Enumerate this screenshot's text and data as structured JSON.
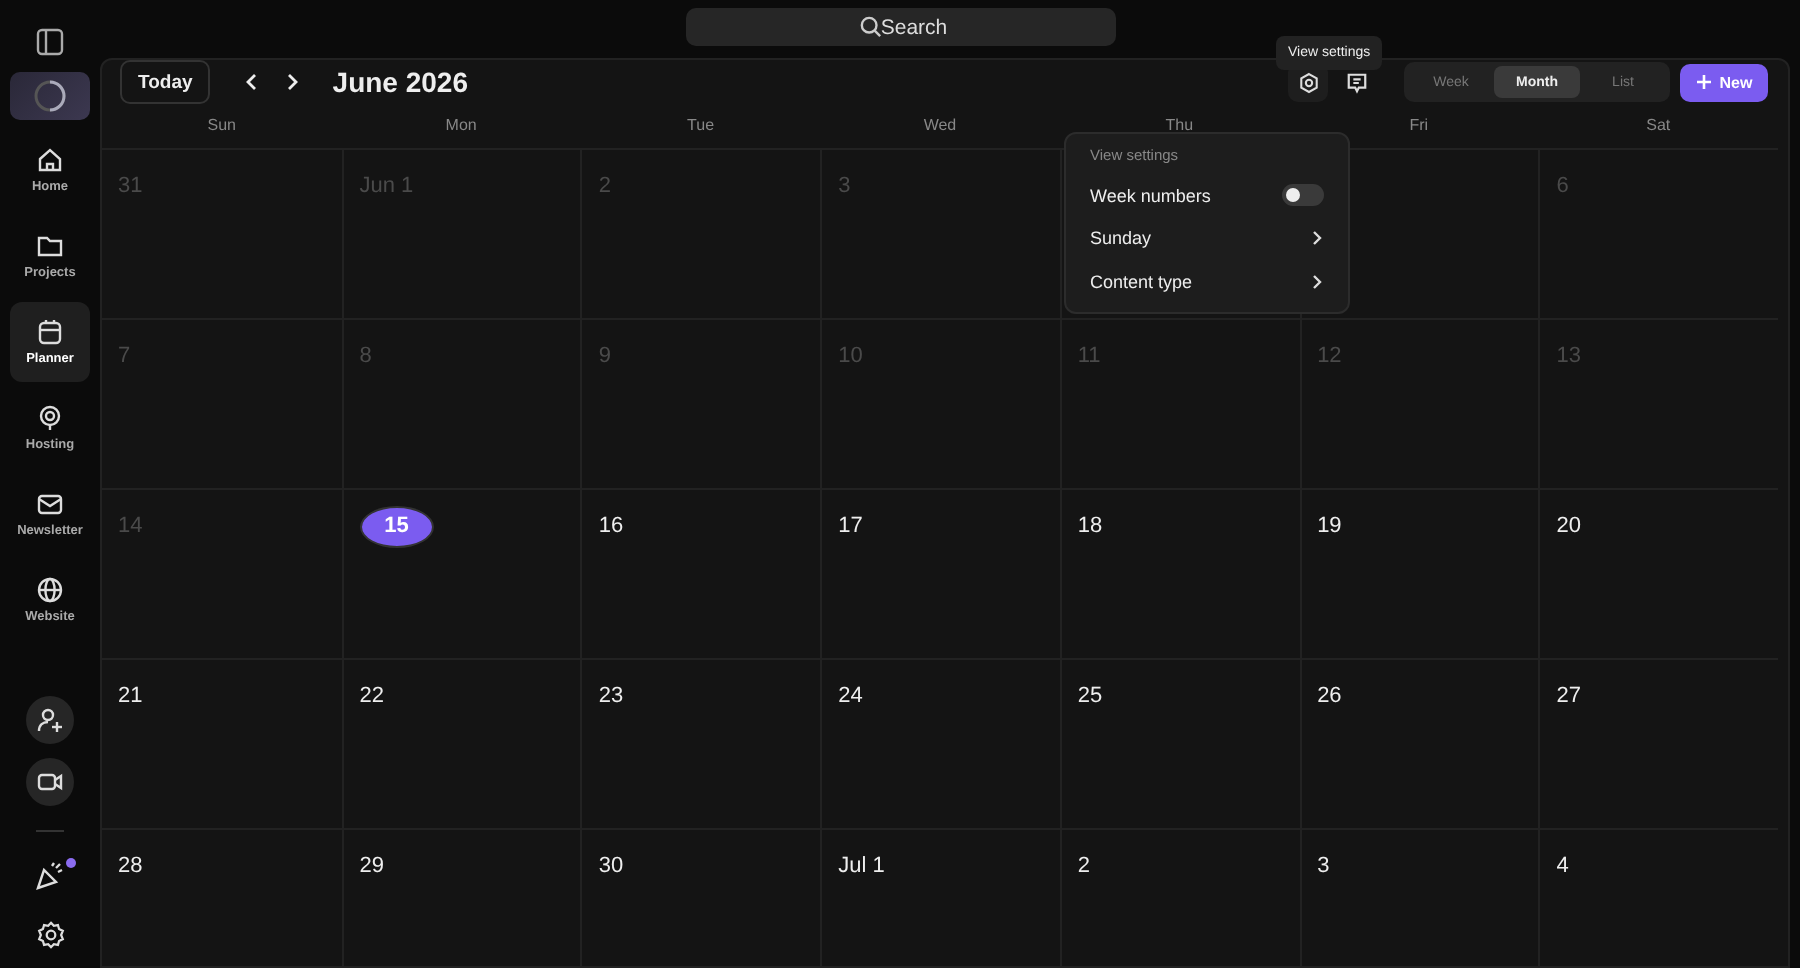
{
  "search": {
    "placeholder": "Search"
  },
  "sidebar": {
    "items": [
      {
        "label": "Home",
        "selected": false
      },
      {
        "label": "Projects",
        "selected": false
      },
      {
        "label": "Planner",
        "selected": true
      },
      {
        "label": "Hosting",
        "selected": false
      },
      {
        "label": "Newsletter",
        "selected": false
      },
      {
        "label": "Website",
        "selected": false
      }
    ],
    "notification_dot": true
  },
  "toolbar": {
    "today_button": "Today",
    "title": "June 2026",
    "tooltip": "View settings",
    "views": [
      {
        "label": "Week",
        "selected": false
      },
      {
        "label": "Month",
        "selected": true
      },
      {
        "label": "List",
        "selected": false
      }
    ],
    "new_button": "New"
  },
  "view_settings_menu": {
    "title": "View settings",
    "items": [
      {
        "kind": "toggle",
        "label": "Week numbers",
        "on": false
      },
      {
        "kind": "submenu",
        "label": "Sunday"
      },
      {
        "kind": "submenu",
        "label": "Content type"
      }
    ]
  },
  "calendar": {
    "weekdays": [
      "Sun",
      "Mon",
      "Tue",
      "Wed",
      "Thu",
      "Fri",
      "Sat"
    ],
    "weeks": [
      [
        {
          "label": "31",
          "past": true,
          "today": false
        },
        {
          "label": "Jun 1",
          "past": true,
          "today": false
        },
        {
          "label": "2",
          "past": true,
          "today": false
        },
        {
          "label": "3",
          "past": true,
          "today": false
        },
        {
          "label": "6",
          "past": true,
          "today": false
        }
      ],
      [
        {
          "label": "7",
          "past": true,
          "today": false
        },
        {
          "label": "8",
          "past": true,
          "today": false
        },
        {
          "label": "9",
          "past": true,
          "today": false
        },
        {
          "label": "10",
          "past": true,
          "today": false
        },
        {
          "label": "11",
          "past": true,
          "today": false
        },
        {
          "label": "12",
          "past": true,
          "today": false
        },
        {
          "label": "13",
          "past": true,
          "today": false
        }
      ],
      [
        {
          "label": "14",
          "past": true,
          "today": false
        },
        {
          "label": "15",
          "past": false,
          "today": true
        },
        {
          "label": "16",
          "past": false,
          "today": false
        },
        {
          "label": "17",
          "past": false,
          "today": false
        },
        {
          "label": "18",
          "past": false,
          "today": false
        },
        {
          "label": "19",
          "past": false,
          "today": false
        },
        {
          "label": "20",
          "past": false,
          "today": false
        }
      ],
      [
        {
          "label": "21",
          "past": false,
          "today": false
        },
        {
          "label": "22",
          "past": false,
          "today": false
        },
        {
          "label": "23",
          "past": false,
          "today": false
        },
        {
          "label": "24",
          "past": false,
          "today": false
        },
        {
          "label": "25",
          "past": false,
          "today": false
        },
        {
          "label": "26",
          "past": false,
          "today": false
        },
        {
          "label": "27",
          "past": false,
          "today": false
        }
      ],
      [
        {
          "label": "28",
          "past": false,
          "today": false
        },
        {
          "label": "29",
          "past": false,
          "today": false
        },
        {
          "label": "30",
          "past": false,
          "today": false
        },
        {
          "label": "Jul 1",
          "past": false,
          "today": false
        },
        {
          "label": "2",
          "past": false,
          "today": false
        },
        {
          "label": "3",
          "past": false,
          "today": false
        },
        {
          "label": "4",
          "past": false,
          "today": false
        }
      ]
    ]
  }
}
